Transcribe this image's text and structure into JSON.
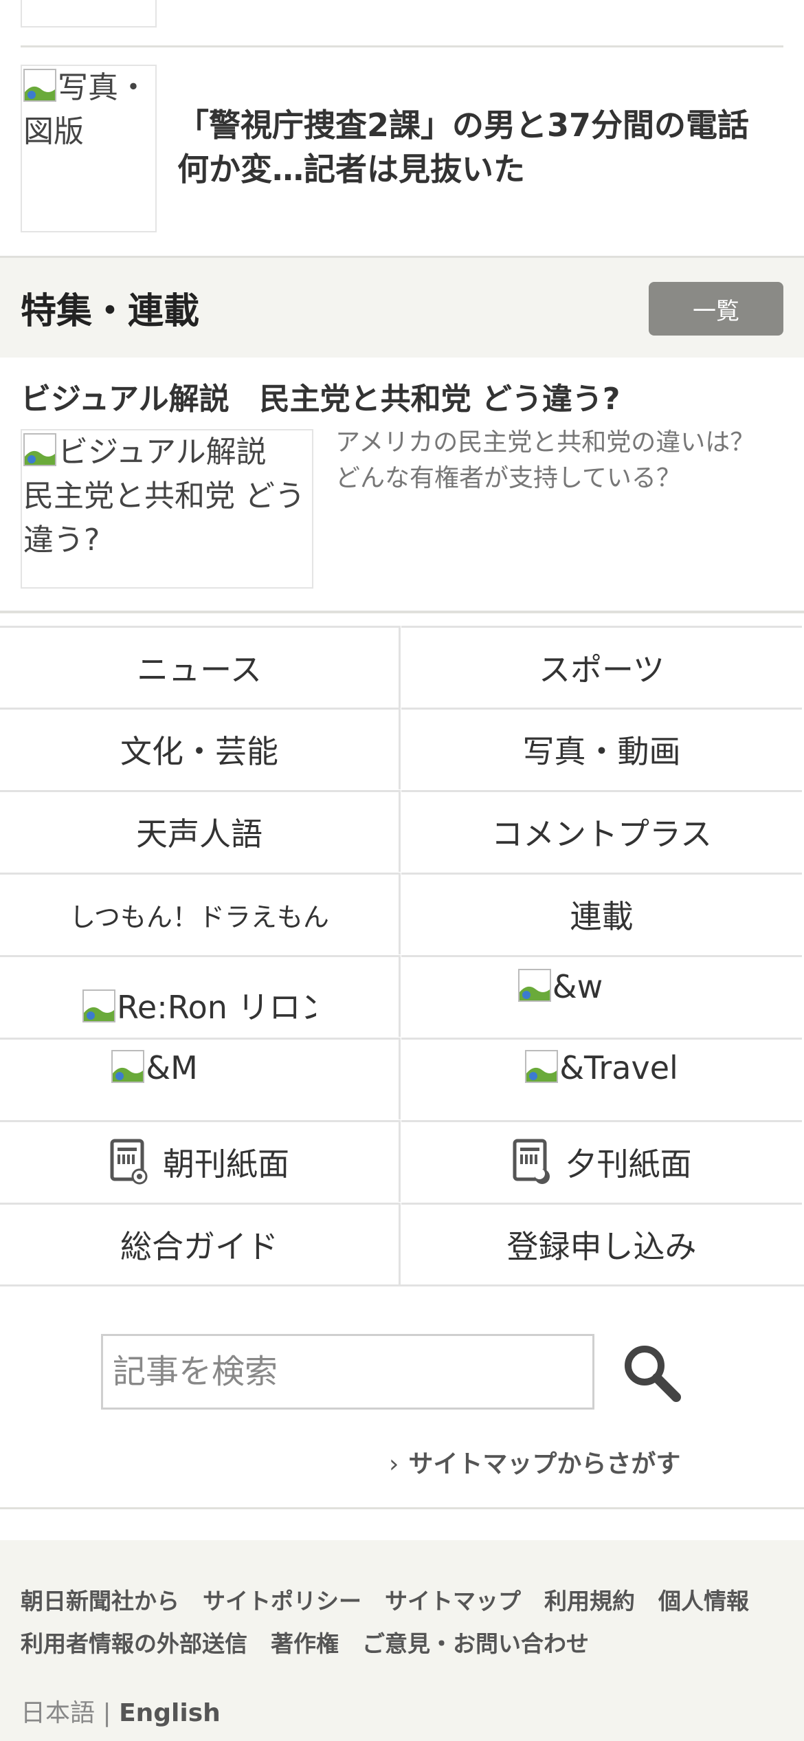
{
  "top_article": {
    "thumb_alt": "写真・図版",
    "title": "「警視庁捜査2課」の男と37分間の電話　何か変…記者は見抜いた"
  },
  "features": {
    "heading": "特集・連載",
    "list_button": "一覧",
    "visual_title": "ビジュアル解説　民主党と共和党 どう違う?",
    "visual_thumb_alt": "ビジュアル解説　民主党と共和党 どう違う?",
    "visual_desc": "アメリカの民主党と共和党の違いは？どんな有権者が支持している？"
  },
  "nav": {
    "news": "ニュース",
    "sports": "スポーツ",
    "culture": "文化・芸能",
    "photo_video": "写真・動画",
    "tensei": "天声人語",
    "comment_plus": "コメントプラス",
    "doraemon": "しつもん！ドラえもん",
    "series": "連載",
    "reron": "Re:Ron リロン",
    "andw": "&w",
    "andm": "&M",
    "andtravel": "&Travel",
    "morning": "朝刊紙面",
    "evening": "夕刊紙面",
    "guide": "総合ガイド",
    "register": "登録申し込み"
  },
  "search": {
    "placeholder": "記事を検索",
    "sitemap_link": "サイトマップからさがす"
  },
  "footer": {
    "links": [
      "朝日新聞社から",
      "サイトポリシー",
      "サイトマップ",
      "利用規約",
      "個人情報",
      "利用者情報の外部送信",
      "著作権",
      "ご意見・お問い合わせ"
    ],
    "lang_ja": "日本語",
    "lang_sep": "|",
    "lang_en": "English"
  },
  "colors": {
    "feature_bg": "#f4f4f0",
    "button_bg": "#8a8a86",
    "footer_bg": "#f4f4ef"
  }
}
